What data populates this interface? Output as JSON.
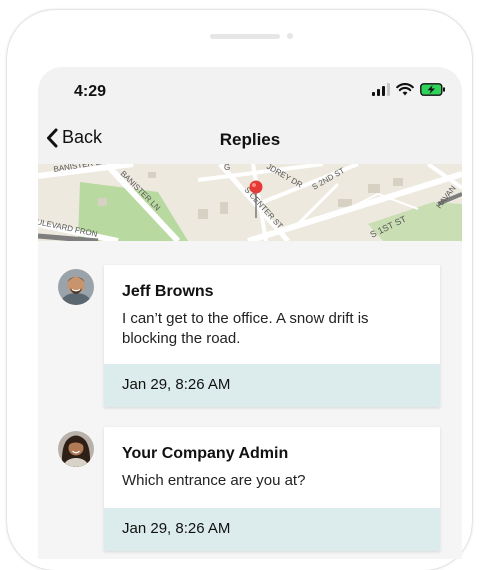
{
  "status_bar": {
    "time": "4:29"
  },
  "nav": {
    "back_label": "Back",
    "title": "Replies"
  },
  "map": {
    "labels": [
      "BANISTER LN",
      "BANISTER LN",
      "ULEVARD FRON",
      "G",
      "JDREY DR",
      "S CENTER ST",
      "S 2ND ST",
      "S 1ST ST",
      "HAVAN"
    ],
    "pin_color": "#e53935",
    "road_color": "#ffffff",
    "park_color": "#b8d9a0"
  },
  "messages": [
    {
      "author": "Jeff Browns",
      "text": "I can’t get to the office. A snow drift is blocking the road.",
      "timestamp": "Jan 29, 8:26 AM",
      "avatar": "man-avatar"
    },
    {
      "author": "Your Company Admin",
      "text": "Which entrance are you at?",
      "timestamp": "Jan 29, 8:26 AM",
      "avatar": "woman-avatar"
    }
  ],
  "colors": {
    "timestamp_bg": "#dcecec",
    "screen_bg": "#f2f2f2"
  }
}
